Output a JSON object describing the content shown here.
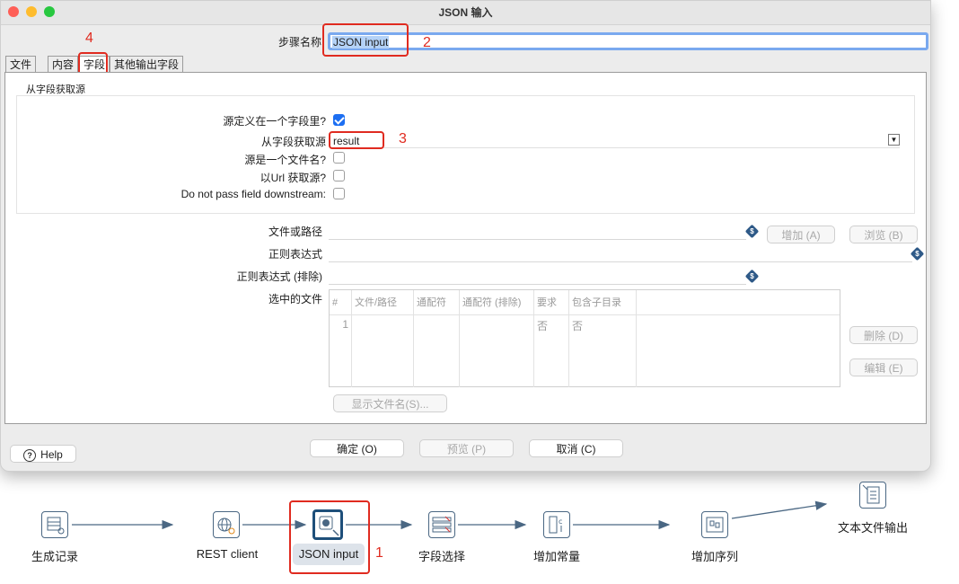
{
  "window": {
    "title": "JSON 输入"
  },
  "step": {
    "label": "步骤名称",
    "value": "JSON input"
  },
  "tabs": [
    "文件",
    "内容",
    "字段",
    "其他输出字段"
  ],
  "group": {
    "title": "从字段获取源",
    "source_in_field_label": "源定义在一个字段里?",
    "source_in_field_checked": true,
    "get_from_field_label": "从字段获取源",
    "get_from_field_value": "result",
    "source_is_filename_label": "源是一个文件名?",
    "source_is_filename_checked": false,
    "read_url_label": "以Url 获取源?",
    "read_url_checked": false,
    "do_not_pass_label": "Do not pass field downstream:",
    "do_not_pass_checked": false
  },
  "files": {
    "file_or_dir_label": "文件或路径",
    "regex_label": "正则表达式",
    "exclude_regex_label": "正则表达式 (排除)",
    "selected_files_label": "选中的文件",
    "add_button": "增加 (A)",
    "browse_button": "浏览 (B)",
    "delete_button": "删除 (D)",
    "edit_button": "编辑 (E)",
    "show_filenames_button": "显示文件名(S)...",
    "dollar_glyph": "$"
  },
  "grid": {
    "columns": [
      "#",
      "文件/路径",
      "通配符",
      "通配符 (排除)",
      "要求",
      "包含子目录"
    ],
    "rows": [
      [
        "1",
        "",
        "",
        "",
        "否",
        "否"
      ]
    ]
  },
  "footer": {
    "help": "Help",
    "ok": "确定 (O)",
    "preview": "预览 (P)",
    "cancel": "取消 (C)"
  },
  "annotations": [
    "1",
    "2",
    "3",
    "4"
  ],
  "workflow": {
    "nodes": [
      "生成记录",
      "REST client",
      "JSON input",
      "字段选择",
      "增加常量",
      "增加序列",
      "文本文件输出"
    ]
  },
  "colors": {
    "accent": "#1d6ff2",
    "annotation_red": "#e02b20",
    "node_border": "#4a6783"
  }
}
